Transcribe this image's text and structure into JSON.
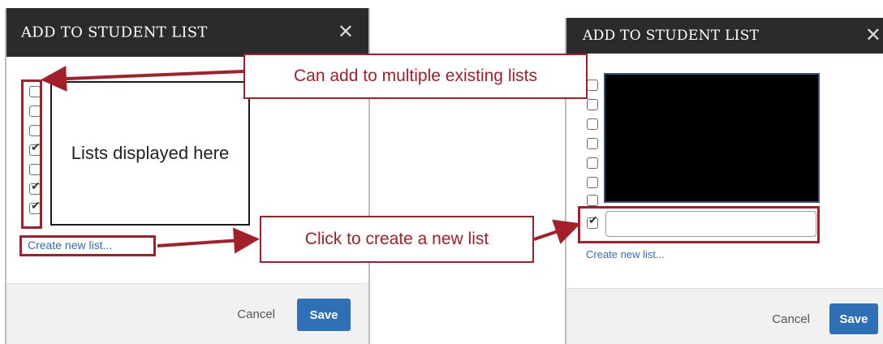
{
  "left_dialog": {
    "title": "ADD TO STUDENT LIST",
    "close_icon": "close-icon",
    "checkboxes": [
      false,
      false,
      false,
      true,
      false,
      true,
      true
    ],
    "list_placeholder": "Lists displayed here",
    "create_link": "Create new list...",
    "cancel_label": "Cancel",
    "save_label": "Save"
  },
  "right_dialog": {
    "title": "ADD TO STUDENT LIST",
    "close_icon": "close-icon",
    "checkboxes": [
      false,
      false,
      false,
      false,
      false,
      false
    ],
    "new_list_checked": true,
    "new_list_input": {
      "value": "",
      "placeholder": ""
    },
    "create_link": "Create new list...",
    "cancel_label": "Cancel",
    "save_label": "Save"
  },
  "callouts": {
    "multiple_lists": "Can add to multiple existing lists",
    "create_new": "Click to create a new list"
  },
  "colors": {
    "header": "#2b2b2b",
    "accent_red": "#a31f2a",
    "save_blue": "#2f6fb6",
    "link_blue": "#2d6fb5"
  }
}
